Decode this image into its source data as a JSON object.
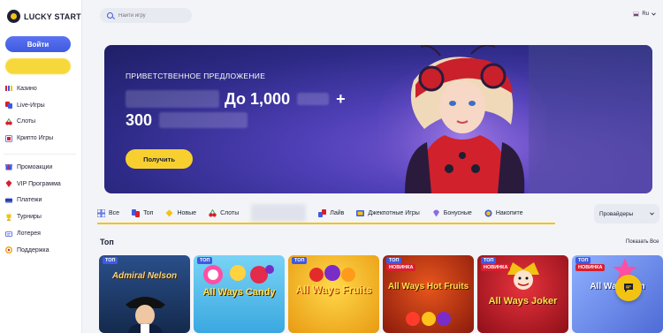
{
  "brand": {
    "name": "LUCKY START"
  },
  "sidebar": {
    "login_label": "Войти",
    "register_label": "",
    "items": [
      {
        "label": "Казино",
        "icon": "casino-icon"
      },
      {
        "label": "Live-Игры",
        "icon": "live-games-icon"
      },
      {
        "label": "Слоты",
        "icon": "slots-icon"
      },
      {
        "label": "Крипто Игры",
        "icon": "crypto-icon"
      }
    ],
    "items2": [
      {
        "label": "Промоакции",
        "icon": "promo-icon"
      },
      {
        "label": "VIP Программа",
        "icon": "vip-icon"
      },
      {
        "label": "Платежи",
        "icon": "payments-icon"
      },
      {
        "label": "Турниры",
        "icon": "tournaments-icon"
      },
      {
        "label": "Лотерея",
        "icon": "lottery-icon"
      },
      {
        "label": "Поддержка",
        "icon": "support-icon"
      }
    ]
  },
  "topbar": {
    "search_placeholder": "Найти игру",
    "language": "Ru"
  },
  "banner": {
    "kicker": "ПРИВЕТСТВЕННОЕ ПРЕДЛОЖЕНИЕ",
    "line1": "До 1,000",
    "line1_suffix": "+",
    "line2": "300",
    "cta": "Получить"
  },
  "categories": [
    {
      "label": "Все",
      "icon": "grid-icon"
    },
    {
      "label": "Топ",
      "icon": "top-icon"
    },
    {
      "label": "Новые",
      "icon": "new-icon"
    },
    {
      "label": "Слоты",
      "icon": "cherry-icon"
    },
    {
      "label": "",
      "icon": ""
    },
    {
      "label": "Лайв",
      "icon": "live-icon"
    },
    {
      "label": "Джекпотные Игры",
      "icon": "jackpot-icon"
    },
    {
      "label": "Бонусные",
      "icon": "diamond-icon"
    },
    {
      "label": "Накопите",
      "icon": "coin-icon"
    }
  ],
  "providers_label": "Провайдеры",
  "section": {
    "title": "Топ",
    "show_all": "Показать Все"
  },
  "badges": {
    "top": "ТОП",
    "new": "НОВИНКА"
  },
  "games": [
    {
      "title": "Admiral Nelson",
      "bg": "#1b3a6b",
      "new": false
    },
    {
      "title": "All Ways Candy",
      "bg": "#4bbbe9",
      "new": false
    },
    {
      "title": "All Ways Fruits",
      "bg": "#f0b21a",
      "new": false
    },
    {
      "title": "All Ways Hot Fruits",
      "bg": "#c8381c",
      "new": true
    },
    {
      "title": "All Ways Joker",
      "bg": "#c91a24",
      "new": true
    },
    {
      "title": "All Ways Win",
      "bg": "#4f6bd6",
      "new": true
    }
  ],
  "colors": {
    "accent": "#3f5ae0",
    "yellow": "#f2c313",
    "bg": "#f3f4f8"
  }
}
